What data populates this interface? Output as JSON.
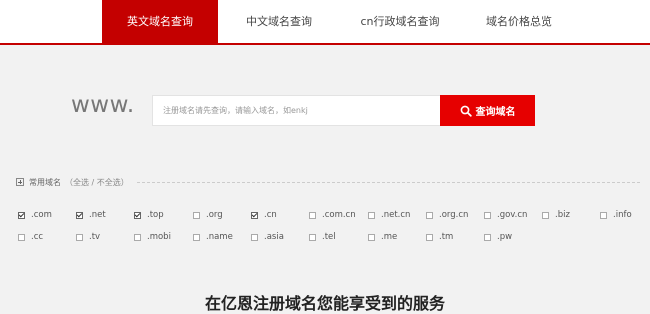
{
  "nav": {
    "tabs": [
      {
        "label": "英文域名查询",
        "active": true
      },
      {
        "label": "中文域名查询",
        "active": false
      },
      {
        "label": "cn行政域名查询",
        "active": false
      },
      {
        "label": "域名价格总览",
        "active": false
      }
    ]
  },
  "search": {
    "prefix": "www.",
    "placeholder": "注册域名请先查询，请输入域名，如enkj",
    "button_label": "查询域名"
  },
  "common": {
    "label": "常用域名",
    "paren_open": "（",
    "select_all": "全选",
    "separator": " / ",
    "select_none": "不全选",
    "paren_close": "）"
  },
  "tlds": [
    {
      "name": ".com",
      "checked": true
    },
    {
      "name": ".net",
      "checked": true
    },
    {
      "name": ".top",
      "checked": true
    },
    {
      "name": ".org",
      "checked": false
    },
    {
      "name": ".cn",
      "checked": true
    },
    {
      "name": ".com.cn",
      "checked": false
    },
    {
      "name": ".net.cn",
      "checked": false
    },
    {
      "name": ".org.cn",
      "checked": false
    },
    {
      "name": ".gov.cn",
      "checked": false
    },
    {
      "name": ".biz",
      "checked": false
    },
    {
      "name": ".info",
      "checked": false
    },
    {
      "name": ".cc",
      "checked": false
    },
    {
      "name": ".tv",
      "checked": false
    },
    {
      "name": ".mobi",
      "checked": false
    },
    {
      "name": ".name",
      "checked": false
    },
    {
      "name": ".asia",
      "checked": false
    },
    {
      "name": ".tel",
      "checked": false
    },
    {
      "name": ".me",
      "checked": false
    },
    {
      "name": ".tm",
      "checked": false
    },
    {
      "name": ".pw",
      "checked": false
    }
  ],
  "footer": {
    "title": "在亿恩注册域名您能享受到的服务"
  },
  "colors": {
    "brand_red": "#c40000",
    "button_red": "#e60000"
  }
}
